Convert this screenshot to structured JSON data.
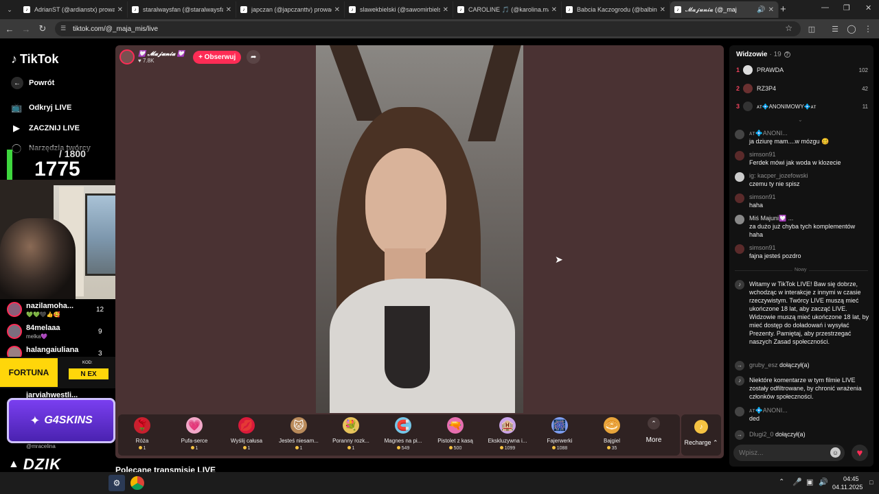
{
  "tabs": [
    {
      "label": "AdrianST (@ardianstx) prowadz"
    },
    {
      "label": "staralwaysfan (@staralwaysfan)"
    },
    {
      "label": "japczan (@japczanttv) prowadz"
    },
    {
      "label": "slawekbielski (@sawomirbielski"
    },
    {
      "label": "CAROLINE 🎵 (@karolina.marc"
    },
    {
      "label": "Babcia Kaczogrodu (@balbinka"
    },
    {
      "label": "𝓜𝓪𝓳𝓾𝓷𝓲𝓪 (@_maj"
    }
  ],
  "address": {
    "url": "tiktok.com/@_maja_mis/live"
  },
  "sidebar": {
    "logo": "TikTok",
    "back": "Powrót",
    "items": [
      {
        "label": "Odkryj LIVE"
      },
      {
        "label": "ZACZNIJ LIVE"
      },
      {
        "label": "Narzędzia twórcy"
      }
    ],
    "list": [
      {
        "name": "nazilamoha...",
        "sub": "💚💚🖤👍🥰",
        "count": "12"
      },
      {
        "name": "84melaaa",
        "sub": "melka💜",
        "count": "9"
      },
      {
        "name": "halangaiuliana",
        "sub": "",
        "count": "3"
      },
      {
        "name": "jarviahwestli...",
        "sub": "",
        "count": ""
      }
    ],
    "last_sub": "@mracelina"
  },
  "overlay": {
    "goal": "/ 1800",
    "current": "1775",
    "fortuna": "FORTUNA",
    "kod_label": "KOD:",
    "kod_value": "N EX",
    "g4skins": "G4SKINS",
    "dzik": "DZIK",
    "polecane": "Polecane transmisje LIVE"
  },
  "host": {
    "name": "💟 𝓜𝓪𝓳𝓾𝓷𝓲𝓪 💟",
    "likes": "7.8K",
    "follow": "+ Obserwuj"
  },
  "gifts": [
    {
      "name": "Róża",
      "price": "1",
      "icon": "🌹",
      "color": "#c8202e"
    },
    {
      "name": "Pufa-serce",
      "price": "1",
      "icon": "💗",
      "color": "#f2a7c8"
    },
    {
      "name": "Wyślij całusa",
      "price": "1",
      "icon": "💋",
      "color": "#d91a3a"
    },
    {
      "name": "Jesteś niesam...",
      "price": "1",
      "icon": "🐱",
      "color": "#b98a5a"
    },
    {
      "name": "Poranny rozk...",
      "price": "1",
      "icon": "💐",
      "color": "#e8c35b"
    },
    {
      "name": "Magnes na pi...",
      "price": "549",
      "icon": "🧲",
      "color": "#74c6e8"
    },
    {
      "name": "Pistolet z kasą",
      "price": "500",
      "icon": "🔫",
      "color": "#e86fb0"
    },
    {
      "name": "Ekskluzywna i...",
      "price": "1099",
      "icon": "🏨",
      "color": "#c9a3e8"
    },
    {
      "name": "Fajerwerki",
      "price": "1088",
      "icon": "🎆",
      "color": "#7f9ef0"
    },
    {
      "name": "Bajgiel",
      "price": "35",
      "icon": "🥯",
      "color": "#e8a43a"
    }
  ],
  "gift_more": "More",
  "recharge": "Recharge",
  "chat": {
    "title": "Widzowie",
    "count": "· 19",
    "viewers": [
      {
        "rank": "1",
        "name": "PRAWDA",
        "score": "102"
      },
      {
        "rank": "2",
        "name": "RZ3P4",
        "score": "42"
      },
      {
        "rank": "3",
        "name": "ᴀᴛ💠ANONIMOWY💠ᴀᴛ",
        "score": "11"
      }
    ],
    "messages": [
      {
        "user": "ᴀᴛ💠ANONI...",
        "text": "ja dziurę mam....w mózgu 🥴"
      },
      {
        "user": "simson91",
        "text": "Ferdek mówi jak woda w klozecie"
      },
      {
        "user": "ig: kacper_jozefowski",
        "text": "czemu ty nie spisz"
      },
      {
        "user": "simson91",
        "text": "haha"
      },
      {
        "user": "Miś Majuni💟 ...",
        "text": "za dużo już chyba tych komplementów haha"
      },
      {
        "user": "simson91",
        "text": "fajna jesteś pozdro"
      }
    ],
    "divider": "Nowy",
    "system1": "Witamy w TikTok LIVE! Baw się dobrze, wchodząc w interakcje z innymi w czasie rzeczywistym. Twórcy LIVE muszą mieć ukończone 18 lat, aby zacząć LIVE. Widzowie muszą mieć ukończone 18 lat, by mieć dostęp do doładowań i wysyłać Prezenty. Pamiętaj, aby przestrzegać naszych Zasad społeczności.",
    "join1_user": "gruby_esz",
    "join1_text": "dołączył(a)",
    "system2": "Niektóre komentarze w tym filmie LIVE zostały odfiltrowane, by chronić wrażenia członków społeczności.",
    "msg_last_user": "ᴀᴛ💠ANONI...",
    "msg_last_text": "ded",
    "join2_user": "Dlugi2_0",
    "join2_text": "dołączył(a)",
    "input_placeholder": "Wpisz..."
  },
  "taskbar": {
    "time": "04:45",
    "date": "04.11.2025"
  },
  "colors": {
    "accent": "#fe2c55",
    "stage_bg": "#4a3233",
    "chat_bg": "#121212"
  }
}
